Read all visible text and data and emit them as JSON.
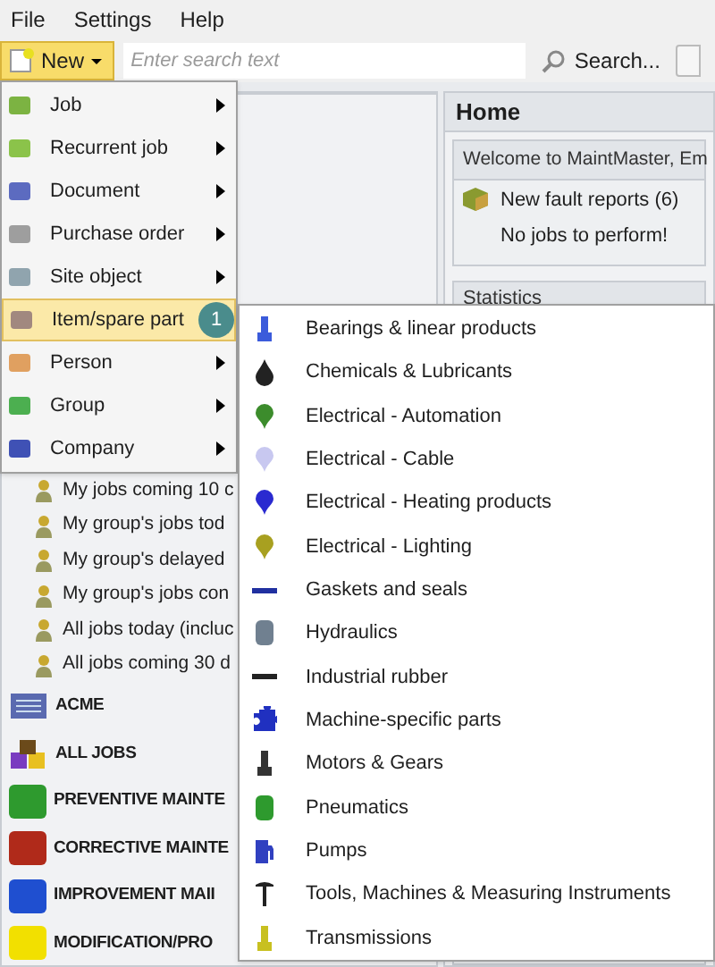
{
  "menubar": [
    "File",
    "Settings",
    "Help"
  ],
  "toolbar": {
    "new_button": "New",
    "search": {
      "placeholder": "Enter search text"
    },
    "search_button": "Search..."
  },
  "left_panel": {
    "jobs": [
      {
        "label": "My jobs coming 10 c"
      },
      {
        "label": "My group's jobs tod"
      },
      {
        "label": "My group's delayed"
      },
      {
        "label": "My group's jobs con"
      },
      {
        "label": "All jobs today (incluc"
      },
      {
        "label": "All jobs coming 30 d"
      }
    ],
    "groups": [
      {
        "label": "ACME",
        "kind": "company"
      },
      {
        "label": "ALL JOBS",
        "kind": "all"
      },
      {
        "label": "PREVENTIVE MAINTE",
        "kind": "category",
        "color": "#2e9a2e"
      },
      {
        "label": "CORRECTIVE MAINTE",
        "kind": "category",
        "color": "#b02a1a"
      },
      {
        "label": "IMPROVEMENT MAII",
        "kind": "category",
        "color": "#1f4fd0"
      },
      {
        "label": "MODIFICATION/PRO",
        "kind": "category",
        "color": "#f2e000"
      }
    ]
  },
  "home": {
    "title": "Home",
    "welcome": "Welcome to MaintMaster, Em",
    "fault_reports": "New fault reports (6)",
    "no_jobs": "No jobs to perform!",
    "statistics": "Statistics"
  },
  "new_menu": [
    {
      "label": "Job",
      "has_submenu": true,
      "selected": false
    },
    {
      "label": "Recurrent job",
      "has_submenu": true,
      "selected": false
    },
    {
      "label": "Document",
      "has_submenu": true,
      "selected": false
    },
    {
      "label": "Purchase order",
      "has_submenu": true,
      "selected": false
    },
    {
      "label": "Site object",
      "has_submenu": true,
      "selected": false
    },
    {
      "label": "Item/spare part",
      "has_submenu": false,
      "selected": true,
      "badge": "1"
    },
    {
      "label": "Person",
      "has_submenu": true,
      "selected": false
    },
    {
      "label": "Group",
      "has_submenu": true,
      "selected": false
    },
    {
      "label": "Company",
      "has_submenu": true,
      "selected": false
    }
  ],
  "submenu": [
    {
      "label": "Bearings & linear products"
    },
    {
      "label": "Chemicals & Lubricants"
    },
    {
      "label": "Electrical - Automation"
    },
    {
      "label": "Electrical - Cable"
    },
    {
      "label": "Electrical - Heating products"
    },
    {
      "label": "Electrical - Lighting"
    },
    {
      "label": "Gaskets and seals"
    },
    {
      "label": "Hydraulics"
    },
    {
      "label": "Industrial rubber"
    },
    {
      "label": "Machine-specific parts"
    },
    {
      "label": "Motors & Gears"
    },
    {
      "label": "Pneumatics"
    },
    {
      "label": "Pumps"
    },
    {
      "label": "Tools, Machines & Measuring Instruments"
    },
    {
      "label": "Transmissions"
    }
  ]
}
